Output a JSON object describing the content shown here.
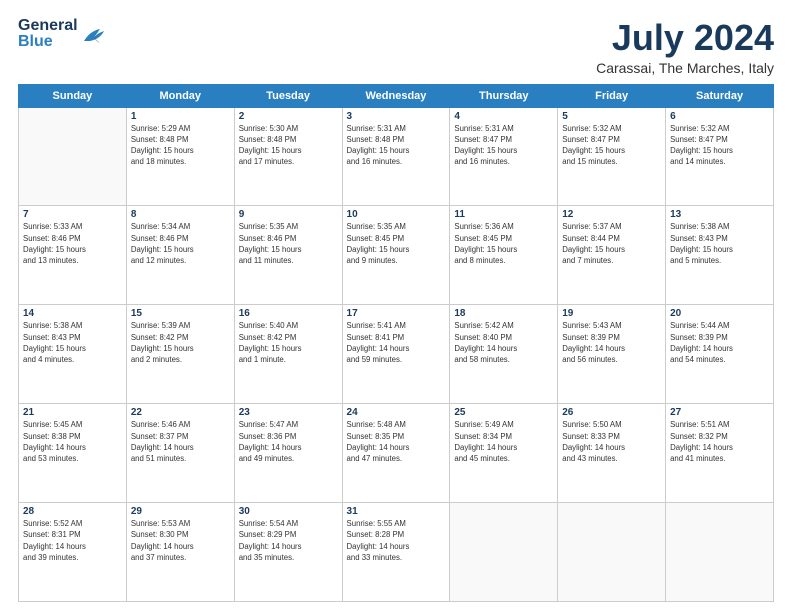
{
  "header": {
    "logo_general": "General",
    "logo_blue": "Blue",
    "month_title": "July 2024",
    "location": "Carassai, The Marches, Italy"
  },
  "days_of_week": [
    "Sunday",
    "Monday",
    "Tuesday",
    "Wednesday",
    "Thursday",
    "Friday",
    "Saturday"
  ],
  "weeks": [
    [
      {
        "day": "",
        "info": ""
      },
      {
        "day": "1",
        "info": "Sunrise: 5:29 AM\nSunset: 8:48 PM\nDaylight: 15 hours\nand 18 minutes."
      },
      {
        "day": "2",
        "info": "Sunrise: 5:30 AM\nSunset: 8:48 PM\nDaylight: 15 hours\nand 17 minutes."
      },
      {
        "day": "3",
        "info": "Sunrise: 5:31 AM\nSunset: 8:48 PM\nDaylight: 15 hours\nand 16 minutes."
      },
      {
        "day": "4",
        "info": "Sunrise: 5:31 AM\nSunset: 8:47 PM\nDaylight: 15 hours\nand 16 minutes."
      },
      {
        "day": "5",
        "info": "Sunrise: 5:32 AM\nSunset: 8:47 PM\nDaylight: 15 hours\nand 15 minutes."
      },
      {
        "day": "6",
        "info": "Sunrise: 5:32 AM\nSunset: 8:47 PM\nDaylight: 15 hours\nand 14 minutes."
      }
    ],
    [
      {
        "day": "7",
        "info": "Sunrise: 5:33 AM\nSunset: 8:46 PM\nDaylight: 15 hours\nand 13 minutes."
      },
      {
        "day": "8",
        "info": "Sunrise: 5:34 AM\nSunset: 8:46 PM\nDaylight: 15 hours\nand 12 minutes."
      },
      {
        "day": "9",
        "info": "Sunrise: 5:35 AM\nSunset: 8:46 PM\nDaylight: 15 hours\nand 11 minutes."
      },
      {
        "day": "10",
        "info": "Sunrise: 5:35 AM\nSunset: 8:45 PM\nDaylight: 15 hours\nand 9 minutes."
      },
      {
        "day": "11",
        "info": "Sunrise: 5:36 AM\nSunset: 8:45 PM\nDaylight: 15 hours\nand 8 minutes."
      },
      {
        "day": "12",
        "info": "Sunrise: 5:37 AM\nSunset: 8:44 PM\nDaylight: 15 hours\nand 7 minutes."
      },
      {
        "day": "13",
        "info": "Sunrise: 5:38 AM\nSunset: 8:43 PM\nDaylight: 15 hours\nand 5 minutes."
      }
    ],
    [
      {
        "day": "14",
        "info": "Sunrise: 5:38 AM\nSunset: 8:43 PM\nDaylight: 15 hours\nand 4 minutes."
      },
      {
        "day": "15",
        "info": "Sunrise: 5:39 AM\nSunset: 8:42 PM\nDaylight: 15 hours\nand 2 minutes."
      },
      {
        "day": "16",
        "info": "Sunrise: 5:40 AM\nSunset: 8:42 PM\nDaylight: 15 hours\nand 1 minute."
      },
      {
        "day": "17",
        "info": "Sunrise: 5:41 AM\nSunset: 8:41 PM\nDaylight: 14 hours\nand 59 minutes."
      },
      {
        "day": "18",
        "info": "Sunrise: 5:42 AM\nSunset: 8:40 PM\nDaylight: 14 hours\nand 58 minutes."
      },
      {
        "day": "19",
        "info": "Sunrise: 5:43 AM\nSunset: 8:39 PM\nDaylight: 14 hours\nand 56 minutes."
      },
      {
        "day": "20",
        "info": "Sunrise: 5:44 AM\nSunset: 8:39 PM\nDaylight: 14 hours\nand 54 minutes."
      }
    ],
    [
      {
        "day": "21",
        "info": "Sunrise: 5:45 AM\nSunset: 8:38 PM\nDaylight: 14 hours\nand 53 minutes."
      },
      {
        "day": "22",
        "info": "Sunrise: 5:46 AM\nSunset: 8:37 PM\nDaylight: 14 hours\nand 51 minutes."
      },
      {
        "day": "23",
        "info": "Sunrise: 5:47 AM\nSunset: 8:36 PM\nDaylight: 14 hours\nand 49 minutes."
      },
      {
        "day": "24",
        "info": "Sunrise: 5:48 AM\nSunset: 8:35 PM\nDaylight: 14 hours\nand 47 minutes."
      },
      {
        "day": "25",
        "info": "Sunrise: 5:49 AM\nSunset: 8:34 PM\nDaylight: 14 hours\nand 45 minutes."
      },
      {
        "day": "26",
        "info": "Sunrise: 5:50 AM\nSunset: 8:33 PM\nDaylight: 14 hours\nand 43 minutes."
      },
      {
        "day": "27",
        "info": "Sunrise: 5:51 AM\nSunset: 8:32 PM\nDaylight: 14 hours\nand 41 minutes."
      }
    ],
    [
      {
        "day": "28",
        "info": "Sunrise: 5:52 AM\nSunset: 8:31 PM\nDaylight: 14 hours\nand 39 minutes."
      },
      {
        "day": "29",
        "info": "Sunrise: 5:53 AM\nSunset: 8:30 PM\nDaylight: 14 hours\nand 37 minutes."
      },
      {
        "day": "30",
        "info": "Sunrise: 5:54 AM\nSunset: 8:29 PM\nDaylight: 14 hours\nand 35 minutes."
      },
      {
        "day": "31",
        "info": "Sunrise: 5:55 AM\nSunset: 8:28 PM\nDaylight: 14 hours\nand 33 minutes."
      },
      {
        "day": "",
        "info": ""
      },
      {
        "day": "",
        "info": ""
      },
      {
        "day": "",
        "info": ""
      }
    ]
  ]
}
